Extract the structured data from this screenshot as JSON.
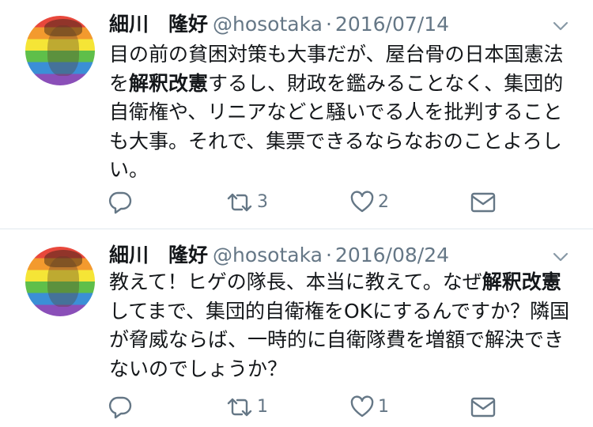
{
  "tweets": [
    {
      "name": "細川　隆好",
      "handle": "@hosotaka",
      "separator": "·",
      "date": "2016/07/14",
      "text_parts": [
        "目の前の貧困対策も大事だが、屋台骨の日本国憲法を",
        "解釈改憲",
        "するし、財政を鑑みることなく、集団的自衛権や、リニアなどと騒いでる人を批判することも大事。それで、集票できるならなおのことよろしい。"
      ],
      "retweet_count": "3",
      "like_count": "2"
    },
    {
      "name": "細川　隆好",
      "handle": "@hosotaka",
      "separator": "·",
      "date": "2016/08/24",
      "text_parts": [
        "教えて！ヒゲの隊長、本当に教えて。なぜ",
        "解釈改憲",
        "してまで、集団的自衛権をOKにするんですか？隣国が脅威ならば、一時的に自衛隊費を増額で解決できないのでしょうか？"
      ],
      "retweet_count": "1",
      "like_count": "1"
    }
  ],
  "icons": {
    "avatar": "rainbow-avatar",
    "caret": "chevron-down-icon",
    "reply": "reply-icon",
    "retweet": "retweet-icon",
    "like": "heart-icon",
    "dm": "envelope-icon"
  },
  "colors": {
    "text": "#14171a",
    "secondary": "#657786",
    "divider": "#e1e8ed"
  }
}
